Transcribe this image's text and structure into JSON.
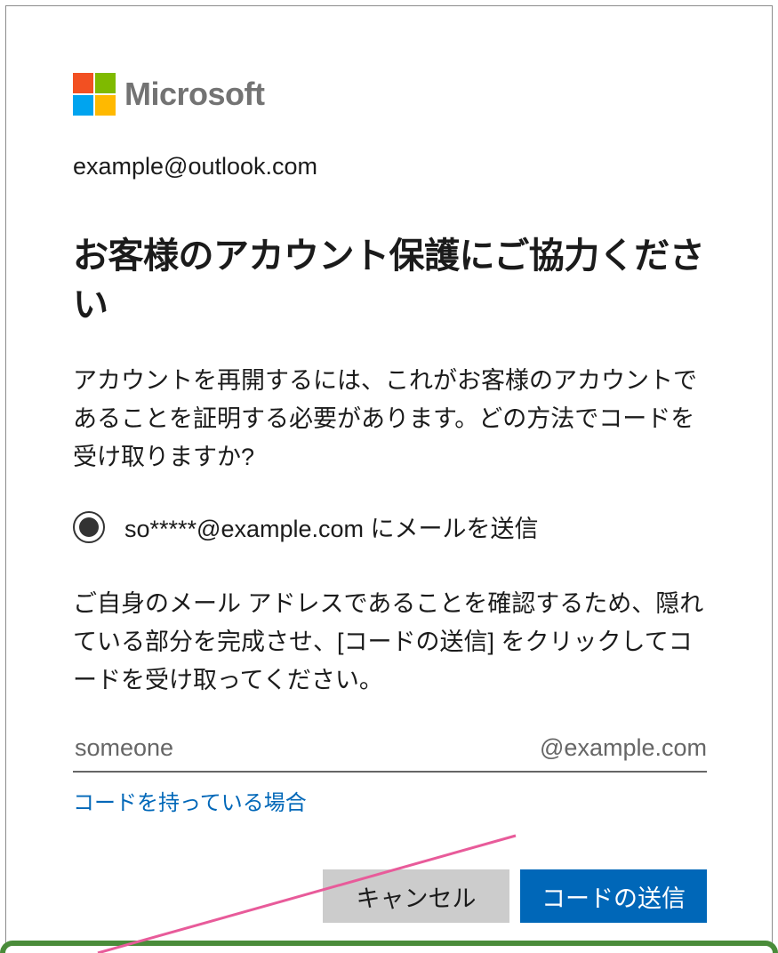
{
  "brand": "Microsoft",
  "account_email": "example@outlook.com",
  "title": "お客様のアカウント保護にご協力ください",
  "description": "アカウントを再開するには、これがお客様のアカウントであることを証明する必要があります。どの方法でコードを受け取りますか?",
  "radio_option": "so*****@example.com にメールを送信",
  "instruction": "ご自身のメール アドレスであることを確認するため、隠れている部分を完成させ、[コードの送信] をクリックしてコードを受け取ってください。",
  "input_placeholder": "someone",
  "email_suffix": "@example.com",
  "have_code_link": "コードを持っている場合",
  "cancel_button": "キャンセル",
  "send_code_button": "コードの送信"
}
